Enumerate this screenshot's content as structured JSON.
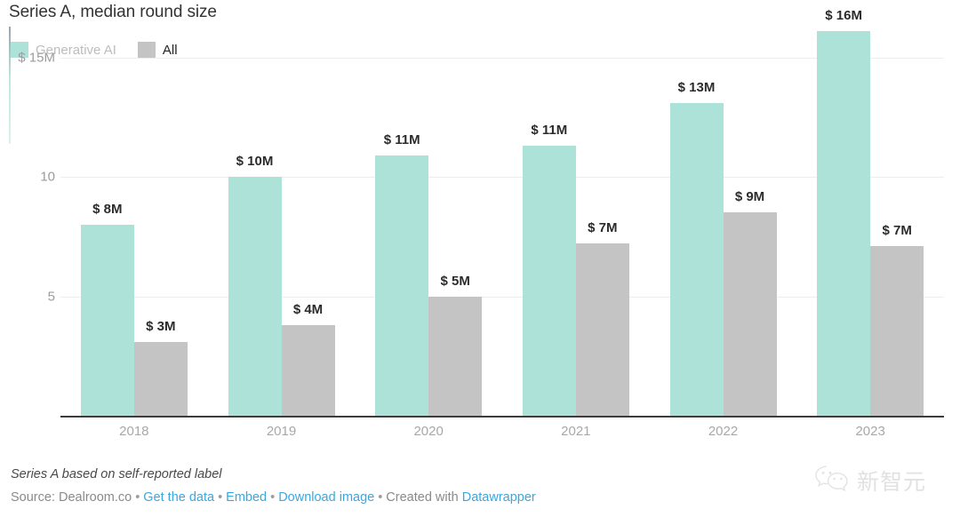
{
  "header": {
    "title": "Series A, median round size",
    "legend": [
      {
        "label": "Generative AI",
        "color": "#ade2d9",
        "swatch_name": "legend-swatch-generative-ai"
      },
      {
        "label": "All",
        "color": "#c4c4c4",
        "swatch_name": "legend-swatch-all"
      }
    ]
  },
  "footer": {
    "note": "Series A based on self-reported label",
    "source_prefix": "Source: Dealroom.co",
    "link_get_data": "Get the data",
    "link_embed": "Embed",
    "link_download": "Download image",
    "created_with": "Created with",
    "link_datawrapper": "Datawrapper",
    "separator": "•"
  },
  "watermark": {
    "text": "新智元",
    "icon": "wechat-icon"
  },
  "chart_data": {
    "type": "bar",
    "title": "Series A, median round size",
    "xlabel": "",
    "ylabel": "",
    "ylim": [
      0,
      17.4
    ],
    "grid": true,
    "legend_position": "top-left",
    "y_ticks": [
      {
        "value": 15,
        "label": "$ 15M"
      },
      {
        "value": 10,
        "label": "10"
      },
      {
        "value": 5,
        "label": "5"
      }
    ],
    "categories": [
      "2018",
      "2019",
      "2020",
      "2021",
      "2022",
      "2023"
    ],
    "series": [
      {
        "name": "Generative AI",
        "color": "#ade2d9",
        "values": [
          8.0,
          10.0,
          10.9,
          11.3,
          13.1,
          16.1
        ],
        "labels": [
          "$ 8M",
          "$ 10M",
          "$ 11M",
          "$ 11M",
          "$ 13M",
          "$ 16M"
        ]
      },
      {
        "name": "All",
        "color": "#c4c4c4",
        "values": [
          3.1,
          3.8,
          5.0,
          7.2,
          8.5,
          7.1
        ],
        "labels": [
          "$ 3M",
          "$ 4M",
          "$ 5M",
          "$ 7M",
          "$ 9M",
          "$ 7M"
        ]
      }
    ],
    "annotation": "Series A based on self-reported label",
    "source": "Dealroom.co"
  }
}
